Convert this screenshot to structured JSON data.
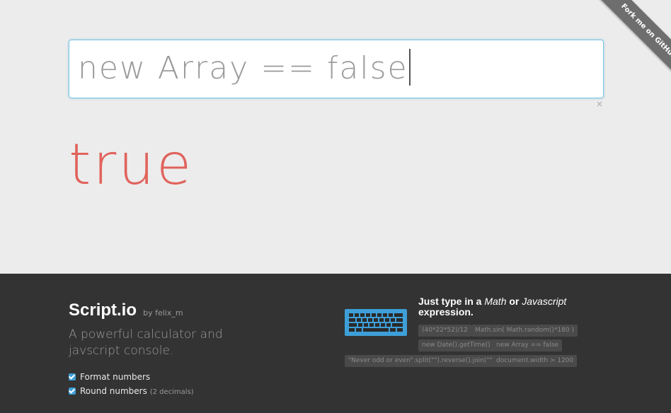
{
  "input": {
    "value": "new Array == false"
  },
  "clear_label": "×",
  "result": "true",
  "ribbon": {
    "label": "Fork me on GitHub"
  },
  "footer": {
    "brand": "Script.io",
    "by": "by felix_m",
    "tagline": "A powerful calculator and javscript console.",
    "options": [
      {
        "label": "Format numbers",
        "note": ""
      },
      {
        "label": "Round numbers",
        "note": "(2 decimals)"
      }
    ],
    "hint": {
      "prefix": "Just type in a ",
      "math": "Math",
      "or": " or ",
      "js": "Javascript",
      "suffix": "expression."
    },
    "examples": [
      "(40*22*52)/12",
      "Math.sin( Math.random()*180 )",
      "new Date().getTime()",
      "new Array == false",
      "\"Never odd or even\".split(\"\").reverse().join(\"\")",
      "document.width > 1200"
    ],
    "keyboard_icon": "keyboard-icon",
    "accent": "#3e9fd8"
  },
  "colors": {
    "result": "#e0635c",
    "footer_bg": "#333333",
    "page_bg": "#ececec"
  }
}
